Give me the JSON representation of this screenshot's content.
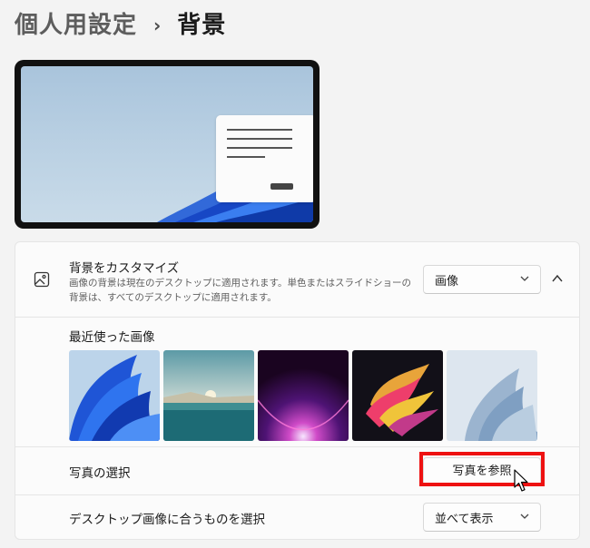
{
  "breadcrumb": {
    "parent": "個人用設定",
    "separator": "›",
    "current": "背景"
  },
  "background_section": {
    "title": "背景をカスタマイズ",
    "description": "画像の背景は現在のデスクトップに適用されます。単色またはスライドショーの背景は、すべてのデスクトップに適用されます。",
    "type_select": {
      "value": "画像"
    }
  },
  "recent": {
    "label": "最近使った画像",
    "images": [
      {
        "name": "Windows 11 Bloom blue"
      },
      {
        "name": "Lake and sunrise"
      },
      {
        "name": "Purple glow"
      },
      {
        "name": "Colorful flow"
      },
      {
        "name": "Light blue bloom"
      }
    ]
  },
  "photo": {
    "label": "写真の選択",
    "browse_label": "写真を参照"
  },
  "fit": {
    "label": "デスクトップ画像に合うものを選択",
    "select": {
      "value": "並べて表示"
    }
  },
  "colors": {
    "highlight": "#ee1111",
    "accent": "#1f5fd6"
  }
}
